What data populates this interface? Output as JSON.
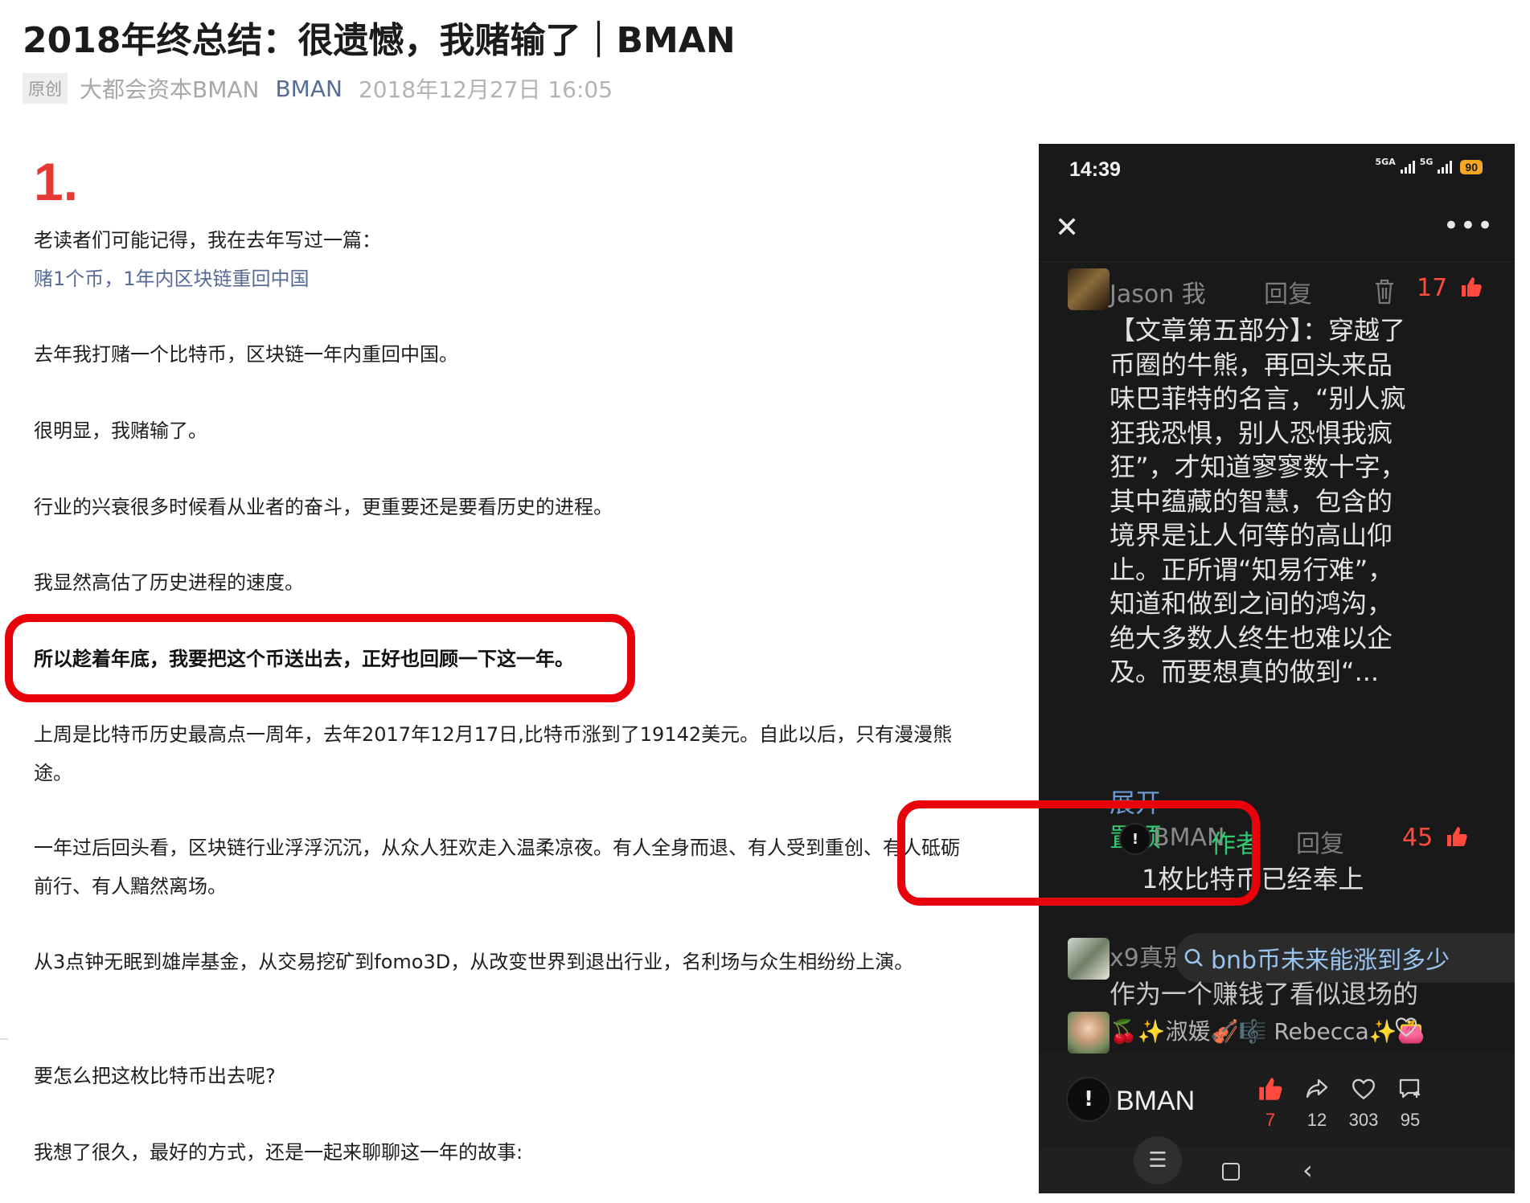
{
  "article": {
    "title": "2018年终总结：很遗憾，我赌输了｜BMAN",
    "meta": {
      "original_tag": "原创",
      "account": "大都会资本BMAN",
      "author": "BMAN",
      "datetime": "2018年12月27日 16:05"
    },
    "section_number": "1.",
    "paragraphs": {
      "p1": "老读者们可能记得，我在去年写过一篇：",
      "p1_link": "赌1个币，1年内区块链重回中国",
      "p2": "去年我打赌一个比特币，区块链一年内重回中国。",
      "p3": "很明显，我赌输了。",
      "p4": "行业的兴衰很多时候看从业者的奋斗，更重要还是要看历史的进程。",
      "p5": "我显然高估了历史进程的速度。",
      "p6_bold": "所以趁着年底，我要把这个币送出去，正好也回顾一下这一年。",
      "p7": "上周是比特币历史最高点一周年，去年2017年12月17日,比特币涨到了19142美元。自此以后，只有漫漫熊途。",
      "p8": "一年过后回头看，区块链行业浮浮沉沉，从众人狂欢走入温柔凉夜。有人全身而退、有人受到重创、有人砥砺前行、有人黯然离场。",
      "p9": "从3点钟无眠到雄岸基金，从交易挖矿到fomo3D，从改变世界到退出行业，名利场与众生相纷纷上演。",
      "p10": "要怎么把这枚比特币出去呢?",
      "p11": "我想了很久，最好的方式，还是一起来聊聊这一年的故事:"
    }
  },
  "phone": {
    "status": {
      "time": "14:39",
      "network1": "5GA",
      "network2": "5G",
      "battery": "90"
    },
    "comments": {
      "jason": {
        "name": "Jason 我",
        "reply": "回复",
        "likes": "17",
        "body": "【文章第五部分】：穿越了币圈的牛熊，再回头来品味巴菲特的名言，“别人疯狂我恐惧，别人恐惧我疯狂”，才知道寥寥数十字，其中蕴藏的智慧，包含的境界是让人何等的高山仰止。正所谓“知易行难”，知道和做到之间的鸿沟，绝大多数人终生也难以企及。而要想真的做到“...",
        "expand": "展开",
        "pinned": "置顶"
      },
      "bman_reply": {
        "name": "BMAN",
        "author_tag": "作者",
        "reply": "回复",
        "likes": "45",
        "body": "1枚比特币已经奉上"
      },
      "x9": {
        "name": "x9真别",
        "line2": "作为一个赚钱了看似退场的"
      },
      "rebecca": {
        "name": "🍒✨淑媛🎻🎼 Rebecca✨👛"
      }
    },
    "search_suggestion": "bnb币未来能涨到多少",
    "bottom": {
      "account_name": "BMAN",
      "likes": "7",
      "shares": "12",
      "favorites": "303",
      "comments": "95"
    }
  },
  "colors": {
    "highlight_border": "#e8000a",
    "like_red": "#ff4a3d",
    "author_green": "#2fcc71",
    "link_blue": "#576b95",
    "section_red": "#e53935"
  }
}
